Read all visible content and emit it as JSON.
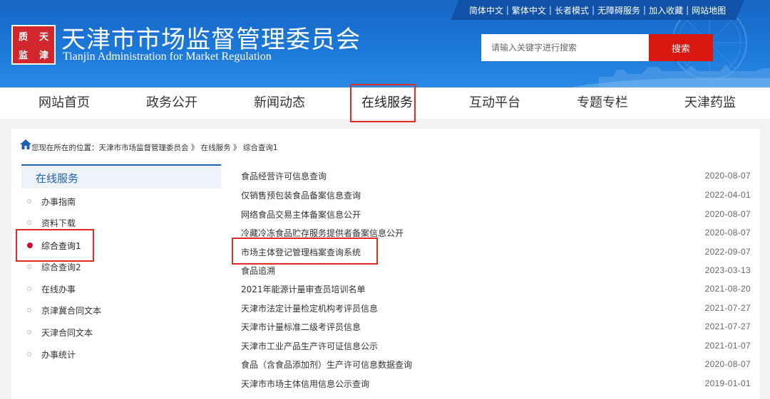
{
  "header": {
    "top_links": [
      "简体中文",
      "繁体中文",
      "长者模式",
      "无障碍服务",
      "加入收藏",
      "网站地图"
    ],
    "logo_chars": [
      "天",
      "津",
      "质",
      "监"
    ],
    "site_title": "天津市市场监督管理委员会",
    "site_subtitle": "Tianjin Administration for Market Regulation",
    "search_placeholder": "请输入关键字进行搜索",
    "search_button": "搜索"
  },
  "nav": [
    "网站首页",
    "政务公开",
    "新闻动态",
    "在线服务",
    "互动平台",
    "专题专栏",
    "天津药监"
  ],
  "breadcrumb": "您现在所在的位置：天津市市场监督管理委员会 》 在线服务 》 综合查询1",
  "sidebar": {
    "title": "在线服务",
    "items": [
      "办事指南",
      "资料下载",
      "综合查询1",
      "综合查询2",
      "在线办事",
      "京津冀合同文本",
      "天津合同文本",
      "办事统计"
    ],
    "active_index": 2
  },
  "list": [
    {
      "title": "食品经营许可信息查询",
      "date": "2020-08-07"
    },
    {
      "title": "仅销售预包装食品备案信息查询",
      "date": "2022-04-01"
    },
    {
      "title": "网络食品交易主体备案信息公开",
      "date": "2020-08-07"
    },
    {
      "title": "冷藏冷冻食品贮存服务提供者备案信息公开",
      "date": "2020-08-07"
    },
    {
      "title": "市场主体登记管理档案查询系统",
      "date": "2022-09-07"
    },
    {
      "title": "食品追溯",
      "date": "2023-03-13"
    },
    {
      "title": "2021年能源计量审查员培训名单",
      "date": "2021-08-20"
    },
    {
      "title": "天津市法定计量检定机构考评员信息",
      "date": "2021-07-27"
    },
    {
      "title": "天津市计量标准二级考评员信息",
      "date": "2021-07-27"
    },
    {
      "title": "天津市工业产品生产许可证信息公示",
      "date": "2021-01-07"
    },
    {
      "title": "食品（含食品添加剂）生产许可信息数据查询",
      "date": "2020-08-07"
    },
    {
      "title": "天津市市场主体信用信息公示查询",
      "date": "2019-01-01"
    }
  ],
  "colors": {
    "banner_blue": "#1c78d8",
    "search_red": "#d9170e",
    "highlight_red": "#e42b1f",
    "sidebar_blue": "#1d5fb8"
  }
}
